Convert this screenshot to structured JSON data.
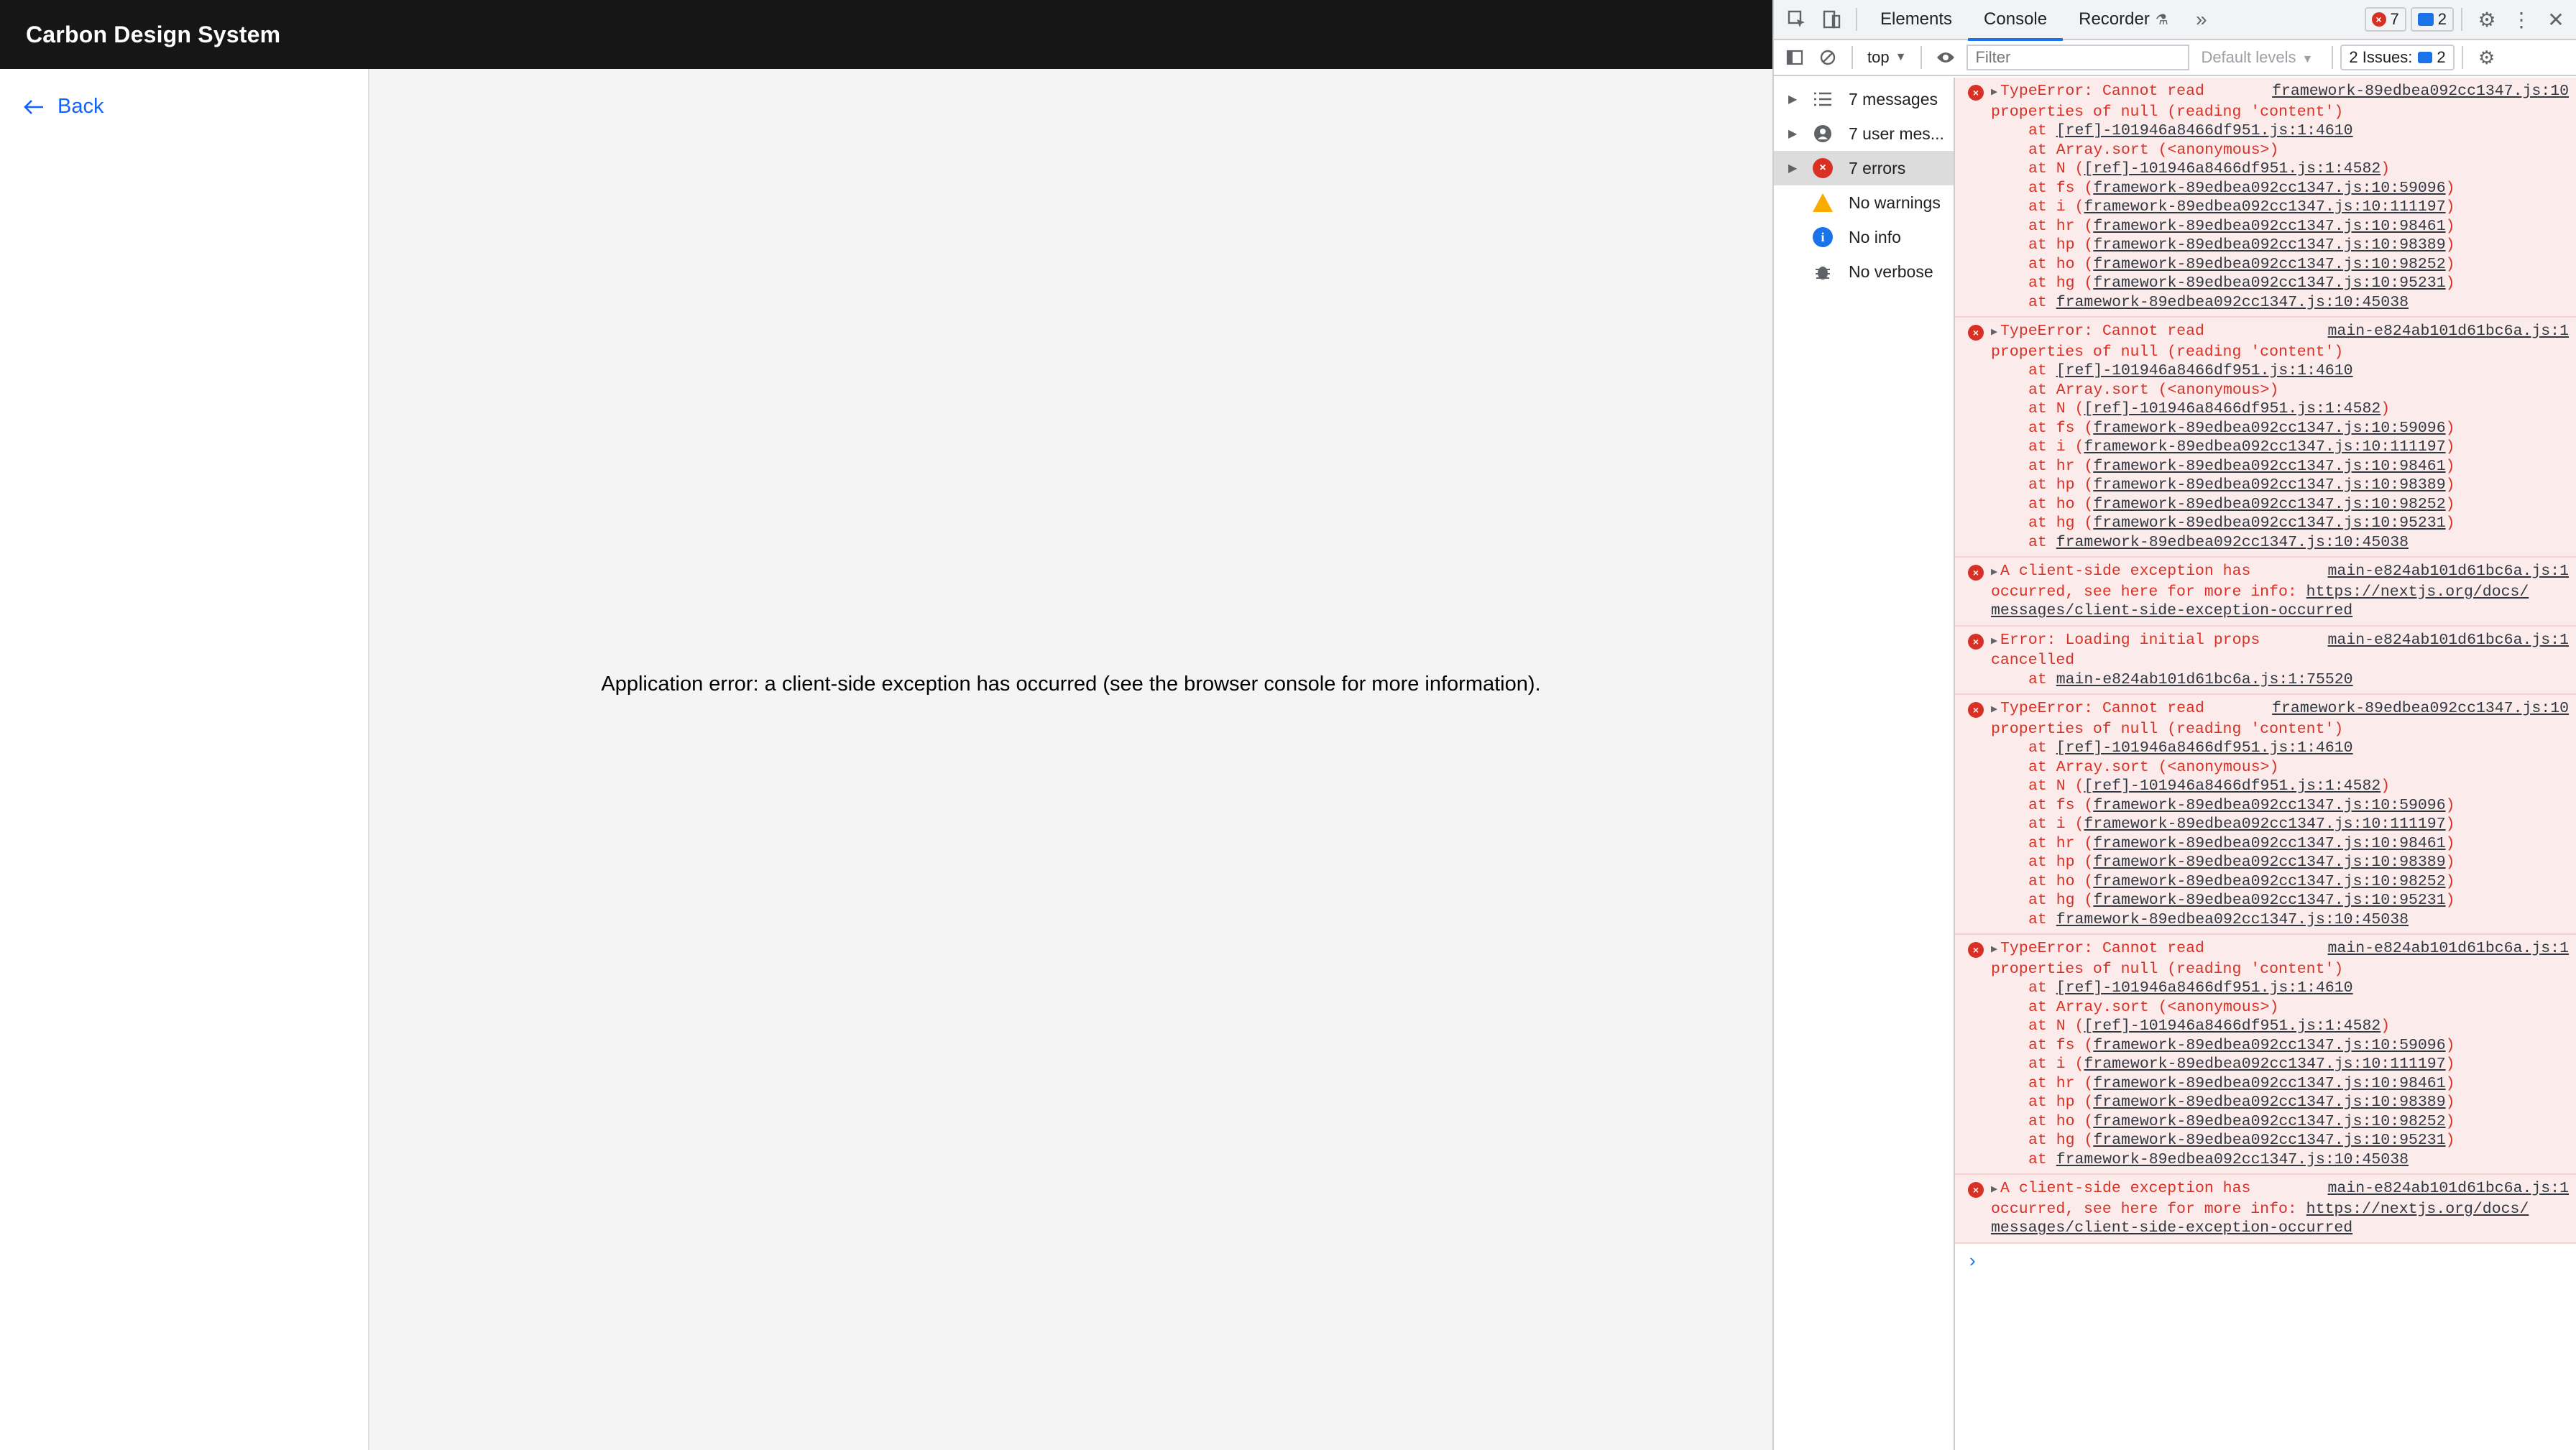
{
  "app": {
    "brand": "Carbon Design System",
    "back_label": "Back",
    "error_message": "Application error: a client-side exception has occurred (see the browser console for more information)."
  },
  "devtools": {
    "tabs": [
      "Elements",
      "Console",
      "Recorder"
    ],
    "error_count": "7",
    "message_count": "2",
    "context": "top",
    "filter_placeholder": "Filter",
    "levels": "Default levels",
    "issues_label": "2 Issues:",
    "issues_count": "2",
    "sidebar": [
      {
        "label": "7 messages",
        "icon": "list-icon"
      },
      {
        "label": "7 user mes...",
        "icon": "user-icon"
      },
      {
        "label": "7 errors",
        "icon": "error-icon"
      },
      {
        "label": "No warnings",
        "icon": "warning-icon"
      },
      {
        "label": "No info",
        "icon": "info-icon"
      },
      {
        "label": "No verbose",
        "icon": "bug-icon"
      }
    ],
    "messages": [
      {
        "head": "TypeError: Cannot read",
        "src": "framework-89edbea092cc1347.js:10",
        "cont": "properties of null (reading 'content')",
        "stack": [
          {
            "pre": "at ",
            "link": "[ref]-101946a8466df951.js:1:4610",
            "post": ""
          },
          {
            "pre": "at Array.sort (<anonymous>)",
            "link": "",
            "post": ""
          },
          {
            "pre": "at N (",
            "link": "[ref]-101946a8466df951.js:1:4582",
            "post": ")"
          },
          {
            "pre": "at fs (",
            "link": "framework-89edbea092cc1347.js:10:59096",
            "post": ")"
          },
          {
            "pre": "at i (",
            "link": "framework-89edbea092cc1347.js:10:111197",
            "post": ")"
          },
          {
            "pre": "at hr (",
            "link": "framework-89edbea092cc1347.js:10:98461",
            "post": ")"
          },
          {
            "pre": "at hp (",
            "link": "framework-89edbea092cc1347.js:10:98389",
            "post": ")"
          },
          {
            "pre": "at ho (",
            "link": "framework-89edbea092cc1347.js:10:98252",
            "post": ")"
          },
          {
            "pre": "at hg (",
            "link": "framework-89edbea092cc1347.js:10:95231",
            "post": ")"
          },
          {
            "pre": "at ",
            "link": "framework-89edbea092cc1347.js:10:45038",
            "post": ""
          }
        ]
      },
      {
        "head": "TypeError: Cannot read",
        "src": "main-e824ab101d61bc6a.js:1",
        "cont": "properties of null (reading 'content')",
        "stack": [
          {
            "pre": "at ",
            "link": "[ref]-101946a8466df951.js:1:4610",
            "post": ""
          },
          {
            "pre": "at Array.sort (<anonymous>)",
            "link": "",
            "post": ""
          },
          {
            "pre": "at N (",
            "link": "[ref]-101946a8466df951.js:1:4582",
            "post": ")"
          },
          {
            "pre": "at fs (",
            "link": "framework-89edbea092cc1347.js:10:59096",
            "post": ")"
          },
          {
            "pre": "at i (",
            "link": "framework-89edbea092cc1347.js:10:111197",
            "post": ")"
          },
          {
            "pre": "at hr (",
            "link": "framework-89edbea092cc1347.js:10:98461",
            "post": ")"
          },
          {
            "pre": "at hp (",
            "link": "framework-89edbea092cc1347.js:10:98389",
            "post": ")"
          },
          {
            "pre": "at ho (",
            "link": "framework-89edbea092cc1347.js:10:98252",
            "post": ")"
          },
          {
            "pre": "at hg (",
            "link": "framework-89edbea092cc1347.js:10:95231",
            "post": ")"
          },
          {
            "pre": "at ",
            "link": "framework-89edbea092cc1347.js:10:45038",
            "post": ""
          }
        ]
      },
      {
        "head": "A client-side exception has",
        "src": "main-e824ab101d61bc6a.js:1",
        "cont": "occurred, see here for more info: ",
        "cont_link": "https://nextjs.org/docs/",
        "cont2_link": "messages/client-side-exception-occurred",
        "stack": []
      },
      {
        "head": "Error: Loading initial props",
        "src": "main-e824ab101d61bc6a.js:1",
        "cont": "cancelled",
        "stack": [
          {
            "pre": "at ",
            "link": "main-e824ab101d61bc6a.js:1:75520",
            "post": ""
          }
        ]
      },
      {
        "head": "TypeError: Cannot read",
        "src": "framework-89edbea092cc1347.js:10",
        "cont": "properties of null (reading 'content')",
        "stack": [
          {
            "pre": "at ",
            "link": "[ref]-101946a8466df951.js:1:4610",
            "post": ""
          },
          {
            "pre": "at Array.sort (<anonymous>)",
            "link": "",
            "post": ""
          },
          {
            "pre": "at N (",
            "link": "[ref]-101946a8466df951.js:1:4582",
            "post": ")"
          },
          {
            "pre": "at fs (",
            "link": "framework-89edbea092cc1347.js:10:59096",
            "post": ")"
          },
          {
            "pre": "at i (",
            "link": "framework-89edbea092cc1347.js:10:111197",
            "post": ")"
          },
          {
            "pre": "at hr (",
            "link": "framework-89edbea092cc1347.js:10:98461",
            "post": ")"
          },
          {
            "pre": "at hp (",
            "link": "framework-89edbea092cc1347.js:10:98389",
            "post": ")"
          },
          {
            "pre": "at ho (",
            "link": "framework-89edbea092cc1347.js:10:98252",
            "post": ")"
          },
          {
            "pre": "at hg (",
            "link": "framework-89edbea092cc1347.js:10:95231",
            "post": ")"
          },
          {
            "pre": "at ",
            "link": "framework-89edbea092cc1347.js:10:45038",
            "post": ""
          }
        ]
      },
      {
        "head": "TypeError: Cannot read",
        "src": "main-e824ab101d61bc6a.js:1",
        "cont": "properties of null (reading 'content')",
        "stack": [
          {
            "pre": "at ",
            "link": "[ref]-101946a8466df951.js:1:4610",
            "post": ""
          },
          {
            "pre": "at Array.sort (<anonymous>)",
            "link": "",
            "post": ""
          },
          {
            "pre": "at N (",
            "link": "[ref]-101946a8466df951.js:1:4582",
            "post": ")"
          },
          {
            "pre": "at fs (",
            "link": "framework-89edbea092cc1347.js:10:59096",
            "post": ")"
          },
          {
            "pre": "at i (",
            "link": "framework-89edbea092cc1347.js:10:111197",
            "post": ")"
          },
          {
            "pre": "at hr (",
            "link": "framework-89edbea092cc1347.js:10:98461",
            "post": ")"
          },
          {
            "pre": "at hp (",
            "link": "framework-89edbea092cc1347.js:10:98389",
            "post": ")"
          },
          {
            "pre": "at ho (",
            "link": "framework-89edbea092cc1347.js:10:98252",
            "post": ")"
          },
          {
            "pre": "at hg (",
            "link": "framework-89edbea092cc1347.js:10:95231",
            "post": ")"
          },
          {
            "pre": "at ",
            "link": "framework-89edbea092cc1347.js:10:45038",
            "post": ""
          }
        ]
      },
      {
        "head": "A client-side exception has",
        "src": "main-e824ab101d61bc6a.js:1",
        "cont": "occurred, see here for more info: ",
        "cont_link": "https://nextjs.org/docs/",
        "cont2_link": "messages/client-side-exception-occurred",
        "stack": []
      }
    ],
    "prompt": "›"
  }
}
